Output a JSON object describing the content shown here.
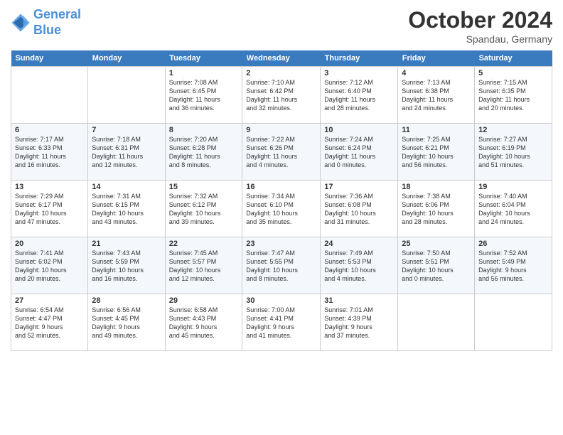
{
  "header": {
    "logo_line1": "General",
    "logo_line2": "Blue",
    "month": "October 2024",
    "location": "Spandau, Germany"
  },
  "weekdays": [
    "Sunday",
    "Monday",
    "Tuesday",
    "Wednesday",
    "Thursday",
    "Friday",
    "Saturday"
  ],
  "weeks": [
    [
      {
        "day": "",
        "info": ""
      },
      {
        "day": "",
        "info": ""
      },
      {
        "day": "1",
        "info": "Sunrise: 7:08 AM\nSunset: 6:45 PM\nDaylight: 11 hours\nand 36 minutes."
      },
      {
        "day": "2",
        "info": "Sunrise: 7:10 AM\nSunset: 6:42 PM\nDaylight: 11 hours\nand 32 minutes."
      },
      {
        "day": "3",
        "info": "Sunrise: 7:12 AM\nSunset: 6:40 PM\nDaylight: 11 hours\nand 28 minutes."
      },
      {
        "day": "4",
        "info": "Sunrise: 7:13 AM\nSunset: 6:38 PM\nDaylight: 11 hours\nand 24 minutes."
      },
      {
        "day": "5",
        "info": "Sunrise: 7:15 AM\nSunset: 6:35 PM\nDaylight: 11 hours\nand 20 minutes."
      }
    ],
    [
      {
        "day": "6",
        "info": "Sunrise: 7:17 AM\nSunset: 6:33 PM\nDaylight: 11 hours\nand 16 minutes."
      },
      {
        "day": "7",
        "info": "Sunrise: 7:18 AM\nSunset: 6:31 PM\nDaylight: 11 hours\nand 12 minutes."
      },
      {
        "day": "8",
        "info": "Sunrise: 7:20 AM\nSunset: 6:28 PM\nDaylight: 11 hours\nand 8 minutes."
      },
      {
        "day": "9",
        "info": "Sunrise: 7:22 AM\nSunset: 6:26 PM\nDaylight: 11 hours\nand 4 minutes."
      },
      {
        "day": "10",
        "info": "Sunrise: 7:24 AM\nSunset: 6:24 PM\nDaylight: 11 hours\nand 0 minutes."
      },
      {
        "day": "11",
        "info": "Sunrise: 7:25 AM\nSunset: 6:21 PM\nDaylight: 10 hours\nand 56 minutes."
      },
      {
        "day": "12",
        "info": "Sunrise: 7:27 AM\nSunset: 6:19 PM\nDaylight: 10 hours\nand 51 minutes."
      }
    ],
    [
      {
        "day": "13",
        "info": "Sunrise: 7:29 AM\nSunset: 6:17 PM\nDaylight: 10 hours\nand 47 minutes."
      },
      {
        "day": "14",
        "info": "Sunrise: 7:31 AM\nSunset: 6:15 PM\nDaylight: 10 hours\nand 43 minutes."
      },
      {
        "day": "15",
        "info": "Sunrise: 7:32 AM\nSunset: 6:12 PM\nDaylight: 10 hours\nand 39 minutes."
      },
      {
        "day": "16",
        "info": "Sunrise: 7:34 AM\nSunset: 6:10 PM\nDaylight: 10 hours\nand 35 minutes."
      },
      {
        "day": "17",
        "info": "Sunrise: 7:36 AM\nSunset: 6:08 PM\nDaylight: 10 hours\nand 31 minutes."
      },
      {
        "day": "18",
        "info": "Sunrise: 7:38 AM\nSunset: 6:06 PM\nDaylight: 10 hours\nand 28 minutes."
      },
      {
        "day": "19",
        "info": "Sunrise: 7:40 AM\nSunset: 6:04 PM\nDaylight: 10 hours\nand 24 minutes."
      }
    ],
    [
      {
        "day": "20",
        "info": "Sunrise: 7:41 AM\nSunset: 6:02 PM\nDaylight: 10 hours\nand 20 minutes."
      },
      {
        "day": "21",
        "info": "Sunrise: 7:43 AM\nSunset: 5:59 PM\nDaylight: 10 hours\nand 16 minutes."
      },
      {
        "day": "22",
        "info": "Sunrise: 7:45 AM\nSunset: 5:57 PM\nDaylight: 10 hours\nand 12 minutes."
      },
      {
        "day": "23",
        "info": "Sunrise: 7:47 AM\nSunset: 5:55 PM\nDaylight: 10 hours\nand 8 minutes."
      },
      {
        "day": "24",
        "info": "Sunrise: 7:49 AM\nSunset: 5:53 PM\nDaylight: 10 hours\nand 4 minutes."
      },
      {
        "day": "25",
        "info": "Sunrise: 7:50 AM\nSunset: 5:51 PM\nDaylight: 10 hours\nand 0 minutes."
      },
      {
        "day": "26",
        "info": "Sunrise: 7:52 AM\nSunset: 5:49 PM\nDaylight: 9 hours\nand 56 minutes."
      }
    ],
    [
      {
        "day": "27",
        "info": "Sunrise: 6:54 AM\nSunset: 4:47 PM\nDaylight: 9 hours\nand 52 minutes."
      },
      {
        "day": "28",
        "info": "Sunrise: 6:56 AM\nSunset: 4:45 PM\nDaylight: 9 hours\nand 49 minutes."
      },
      {
        "day": "29",
        "info": "Sunrise: 6:58 AM\nSunset: 4:43 PM\nDaylight: 9 hours\nand 45 minutes."
      },
      {
        "day": "30",
        "info": "Sunrise: 7:00 AM\nSunset: 4:41 PM\nDaylight: 9 hours\nand 41 minutes."
      },
      {
        "day": "31",
        "info": "Sunrise: 7:01 AM\nSunset: 4:39 PM\nDaylight: 9 hours\nand 37 minutes."
      },
      {
        "day": "",
        "info": ""
      },
      {
        "day": "",
        "info": ""
      }
    ]
  ]
}
